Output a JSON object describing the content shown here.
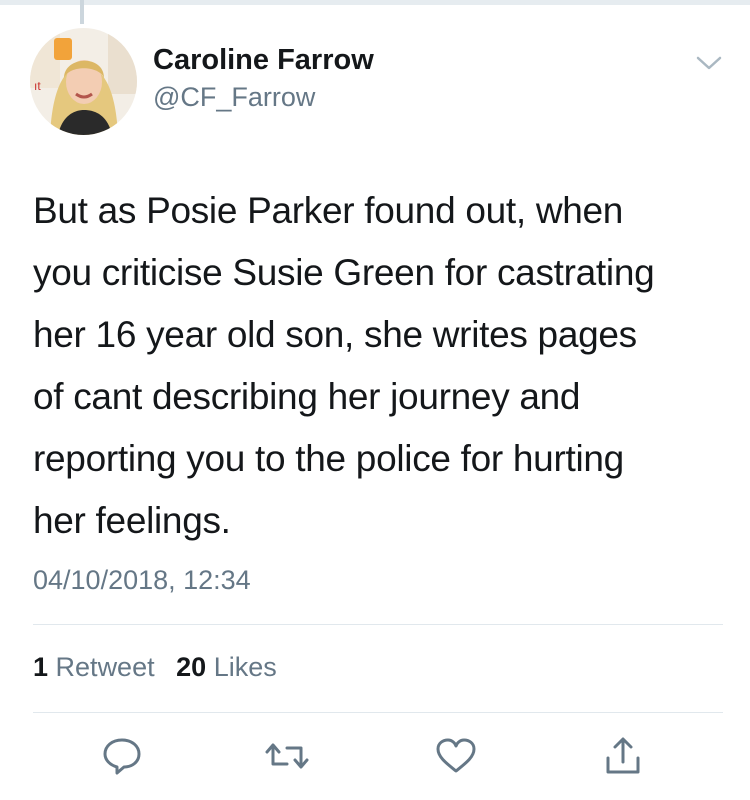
{
  "tweet": {
    "author": {
      "display_name": "Caroline Farrow",
      "handle": "@CF_Farrow"
    },
    "text_lines": [
      "But as Posie Parker found out, when",
      "you criticise Susie Green for castrating",
      "her 16 year old son, she writes pages",
      "of cant describing her journey and",
      "reporting you to the police for hurting",
      "her feelings."
    ],
    "timestamp": "04/10/2018, 12:34",
    "stats": {
      "retweet_count": "1",
      "retweet_label": "Retweet",
      "like_count": "20",
      "like_label": "Likes"
    }
  },
  "icons": {
    "menu": "chevron-down-icon",
    "reply": "reply-icon",
    "retweet": "retweet-icon",
    "like": "heart-icon",
    "share": "share-icon"
  },
  "colors": {
    "primary_text": "#14171a",
    "secondary_text": "#657786",
    "divider": "#e1e8ed"
  }
}
